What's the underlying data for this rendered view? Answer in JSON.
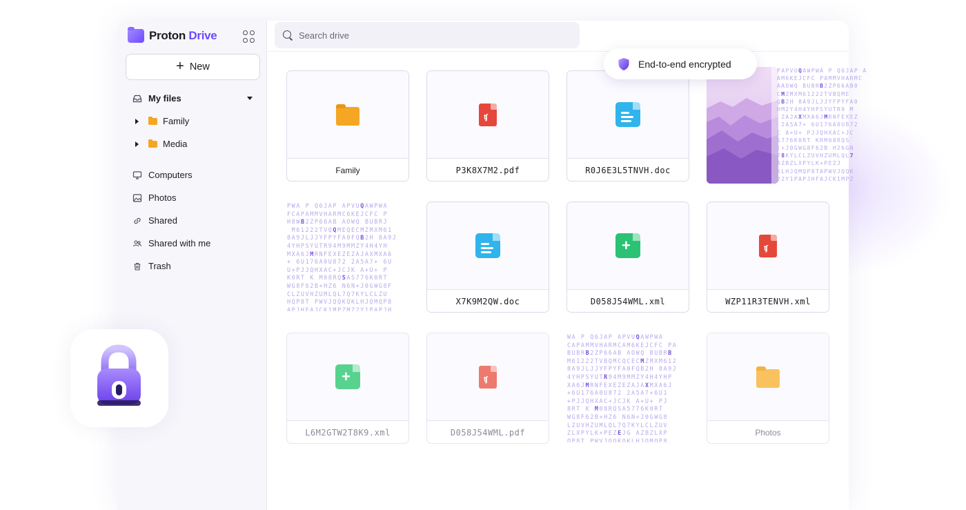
{
  "brand": {
    "name_part1": "Proton",
    "name_part2": "Drive",
    "color": "#6d4aff"
  },
  "sidebar": {
    "new_label": "New",
    "my_files": "My files",
    "folders": [
      {
        "label": "Family"
      },
      {
        "label": "Media"
      }
    ],
    "items": [
      {
        "label": "Computers",
        "icon": "monitor-icon"
      },
      {
        "label": "Photos",
        "icon": "image-icon"
      },
      {
        "label": "Shared",
        "icon": "link-icon"
      },
      {
        "label": "Shared with me",
        "icon": "users-icon"
      },
      {
        "label": "Trash",
        "icon": "trash-icon"
      }
    ]
  },
  "search": {
    "placeholder": "Search drive"
  },
  "badge": {
    "label": "End-to-end encrypted"
  },
  "files": [
    {
      "name": "Family",
      "type": "folder"
    },
    {
      "name": "P3K8X7M2.pdf",
      "type": "pdf"
    },
    {
      "name": "R0J6E3L5TNVH.doc",
      "type": "doc"
    },
    {
      "name": "",
      "type": "photo"
    },
    {
      "name": "",
      "type": "encrypted"
    },
    {
      "name": "X7K9M2QW.doc",
      "type": "doc"
    },
    {
      "name": "D058J54WML.xml",
      "type": "sheet"
    },
    {
      "name": "WZP11R3TENVH.xml",
      "type": "pdf"
    },
    {
      "name": "L6M2GTW2T8K9.xml",
      "type": "sheet"
    },
    {
      "name": "D058J54WML.pdf",
      "type": "pdf"
    },
    {
      "name": "",
      "type": "encrypted"
    },
    {
      "name": "Photos",
      "type": "folder"
    }
  ]
}
